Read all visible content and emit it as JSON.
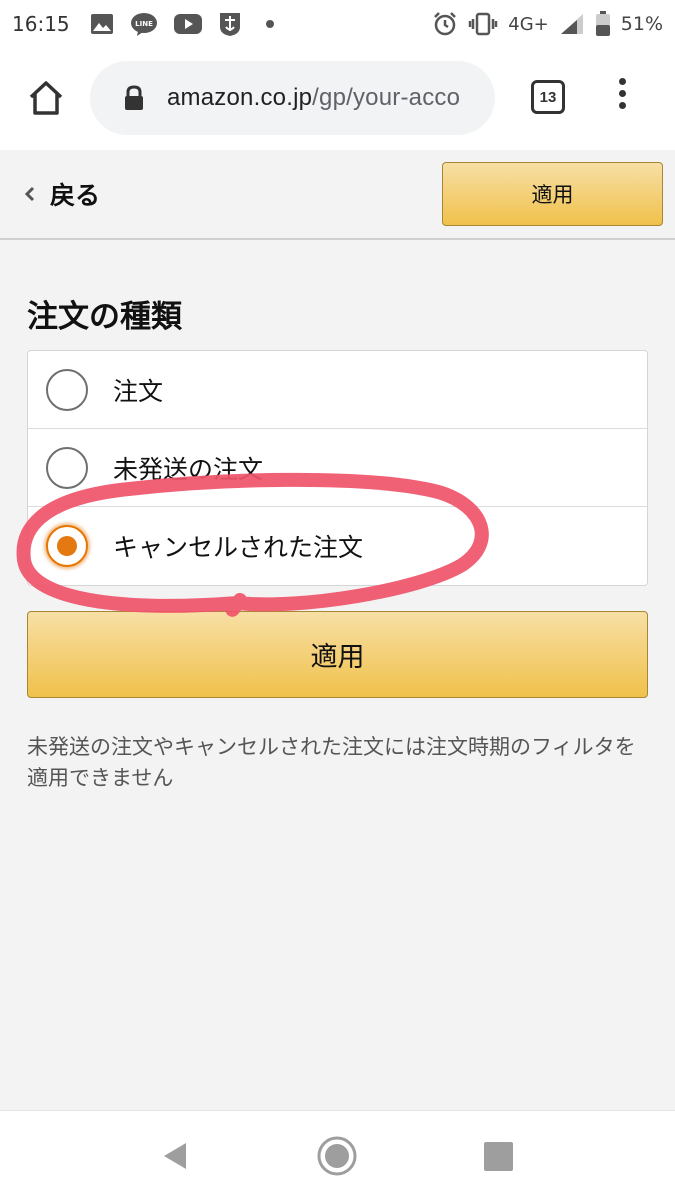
{
  "status_bar": {
    "time": "16:15",
    "network": "4G+",
    "battery": "51%",
    "icons": [
      "gallery-icon",
      "line-app-icon",
      "youtube-icon",
      "game-app-icon",
      "notification-dot",
      "alarm-icon",
      "vibrate-icon",
      "signal-icon",
      "battery-icon"
    ]
  },
  "browser": {
    "url_domain": "amazon.co.jp",
    "url_path": "/gp/your-acco",
    "tab_count": "13"
  },
  "header": {
    "back_label": "戻る",
    "apply_label": "適用"
  },
  "filter": {
    "title": "注文の種類",
    "options": [
      {
        "label": "注文",
        "selected": false
      },
      {
        "label": "未発送の注文",
        "selected": false
      },
      {
        "label": "キャンセルされた注文",
        "selected": true
      }
    ],
    "apply_label": "適用",
    "note": "未発送の注文やキャンセルされた注文には注文時期のフィルタを適用できません"
  },
  "colors": {
    "accent_radio": "#e47911",
    "button_gradient_top": "#f7dfa5",
    "button_gradient_bottom": "#f0c14b",
    "annotation": "#f0546a"
  }
}
